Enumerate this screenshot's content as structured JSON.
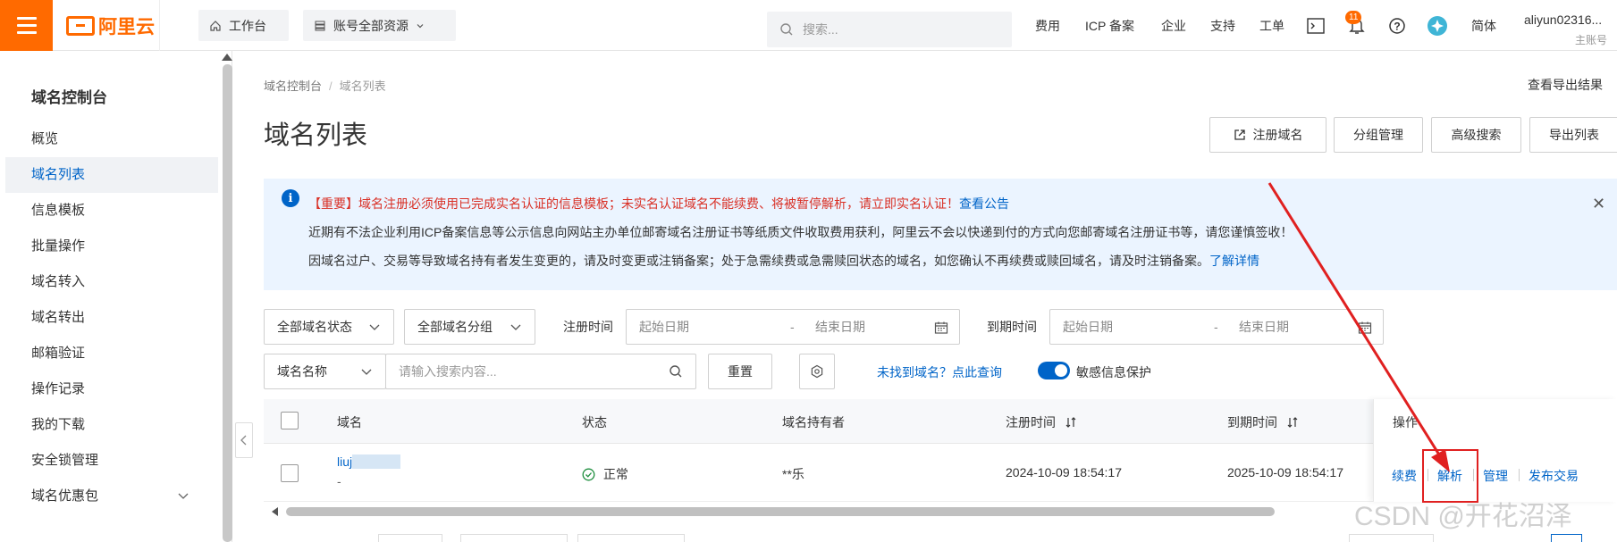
{
  "topbar": {
    "brand": "阿里云",
    "workbench": "工作台",
    "resources": "账号全部资源",
    "search_placeholder": "搜索...",
    "nav": [
      "费用",
      "ICP 备案",
      "企业",
      "支持",
      "工单"
    ],
    "notification_count": "11",
    "language": "简体",
    "user_name": "aliyun02316...",
    "user_role": "主账号"
  },
  "sidebar": {
    "title": "域名控制台",
    "items": [
      "概览",
      "域名列表",
      "信息模板",
      "批量操作",
      "域名转入",
      "域名转出",
      "邮箱验证",
      "操作记录",
      "我的下载",
      "安全锁管理",
      "域名优惠包"
    ],
    "active_index": 1
  },
  "breadcrumb": [
    "域名控制台",
    "域名列表"
  ],
  "export_result": "查看导出结果",
  "page_title": "域名列表",
  "header_buttons": [
    "注册域名",
    "分组管理",
    "高级搜索",
    "导出列表"
  ],
  "notice": {
    "line1": "【重要】域名注册必须使用已完成实名认证的信息模板；未实名认证域名不能续费、将被暂停解析，请立即实名认证！",
    "line1_link": "查看公告",
    "line2": "近期有不法企业利用ICP备案信息等公示信息向网站主办单位邮寄域名注册证书等纸质文件收取费用获利，阿里云不会以快递到付的方式向您邮寄域名注册证书等，请您谨慎签收！",
    "line3": "因域名过户、交易等导致域名持有者发生变更的，请及时变更或注销备案；处于急需续费或急需赎回状态的域名，如您确认不再续费或赎回域名，请及时注销备案。",
    "line3_link": "了解详情"
  },
  "filters": {
    "status": "全部域名状态",
    "group": "全部域名分组",
    "reg_time_label": "注册时间",
    "exp_time_label": "到期时间",
    "start_date": "起始日期",
    "end_date": "结束日期",
    "date_sep": "-",
    "search_field": "域名名称",
    "search_placeholder": "请输入搜索内容...",
    "reset": "重置",
    "not_found": "未找到域名？点此查询",
    "privacy": "敏感信息保护"
  },
  "table": {
    "columns": [
      "域名",
      "状态",
      "域名持有者",
      "注册时间",
      "到期时间",
      "操作"
    ],
    "rows": [
      {
        "domain": "liuj",
        "domain_sub": "-",
        "status": "正常",
        "holder": "**乐",
        "registered": "2024-10-09 18:54:17",
        "expires": "2025-10-09 18:54:17",
        "actions": [
          "续费",
          "解析",
          "管理",
          "发布交易"
        ]
      }
    ]
  },
  "watermark": "CSDN @开花沼泽",
  "colors": {
    "brand": "#ff6a00",
    "link": "#0064c8",
    "warn": "#d93026",
    "highlight": "#e02020",
    "notice_bg": "#ebf4ff"
  }
}
